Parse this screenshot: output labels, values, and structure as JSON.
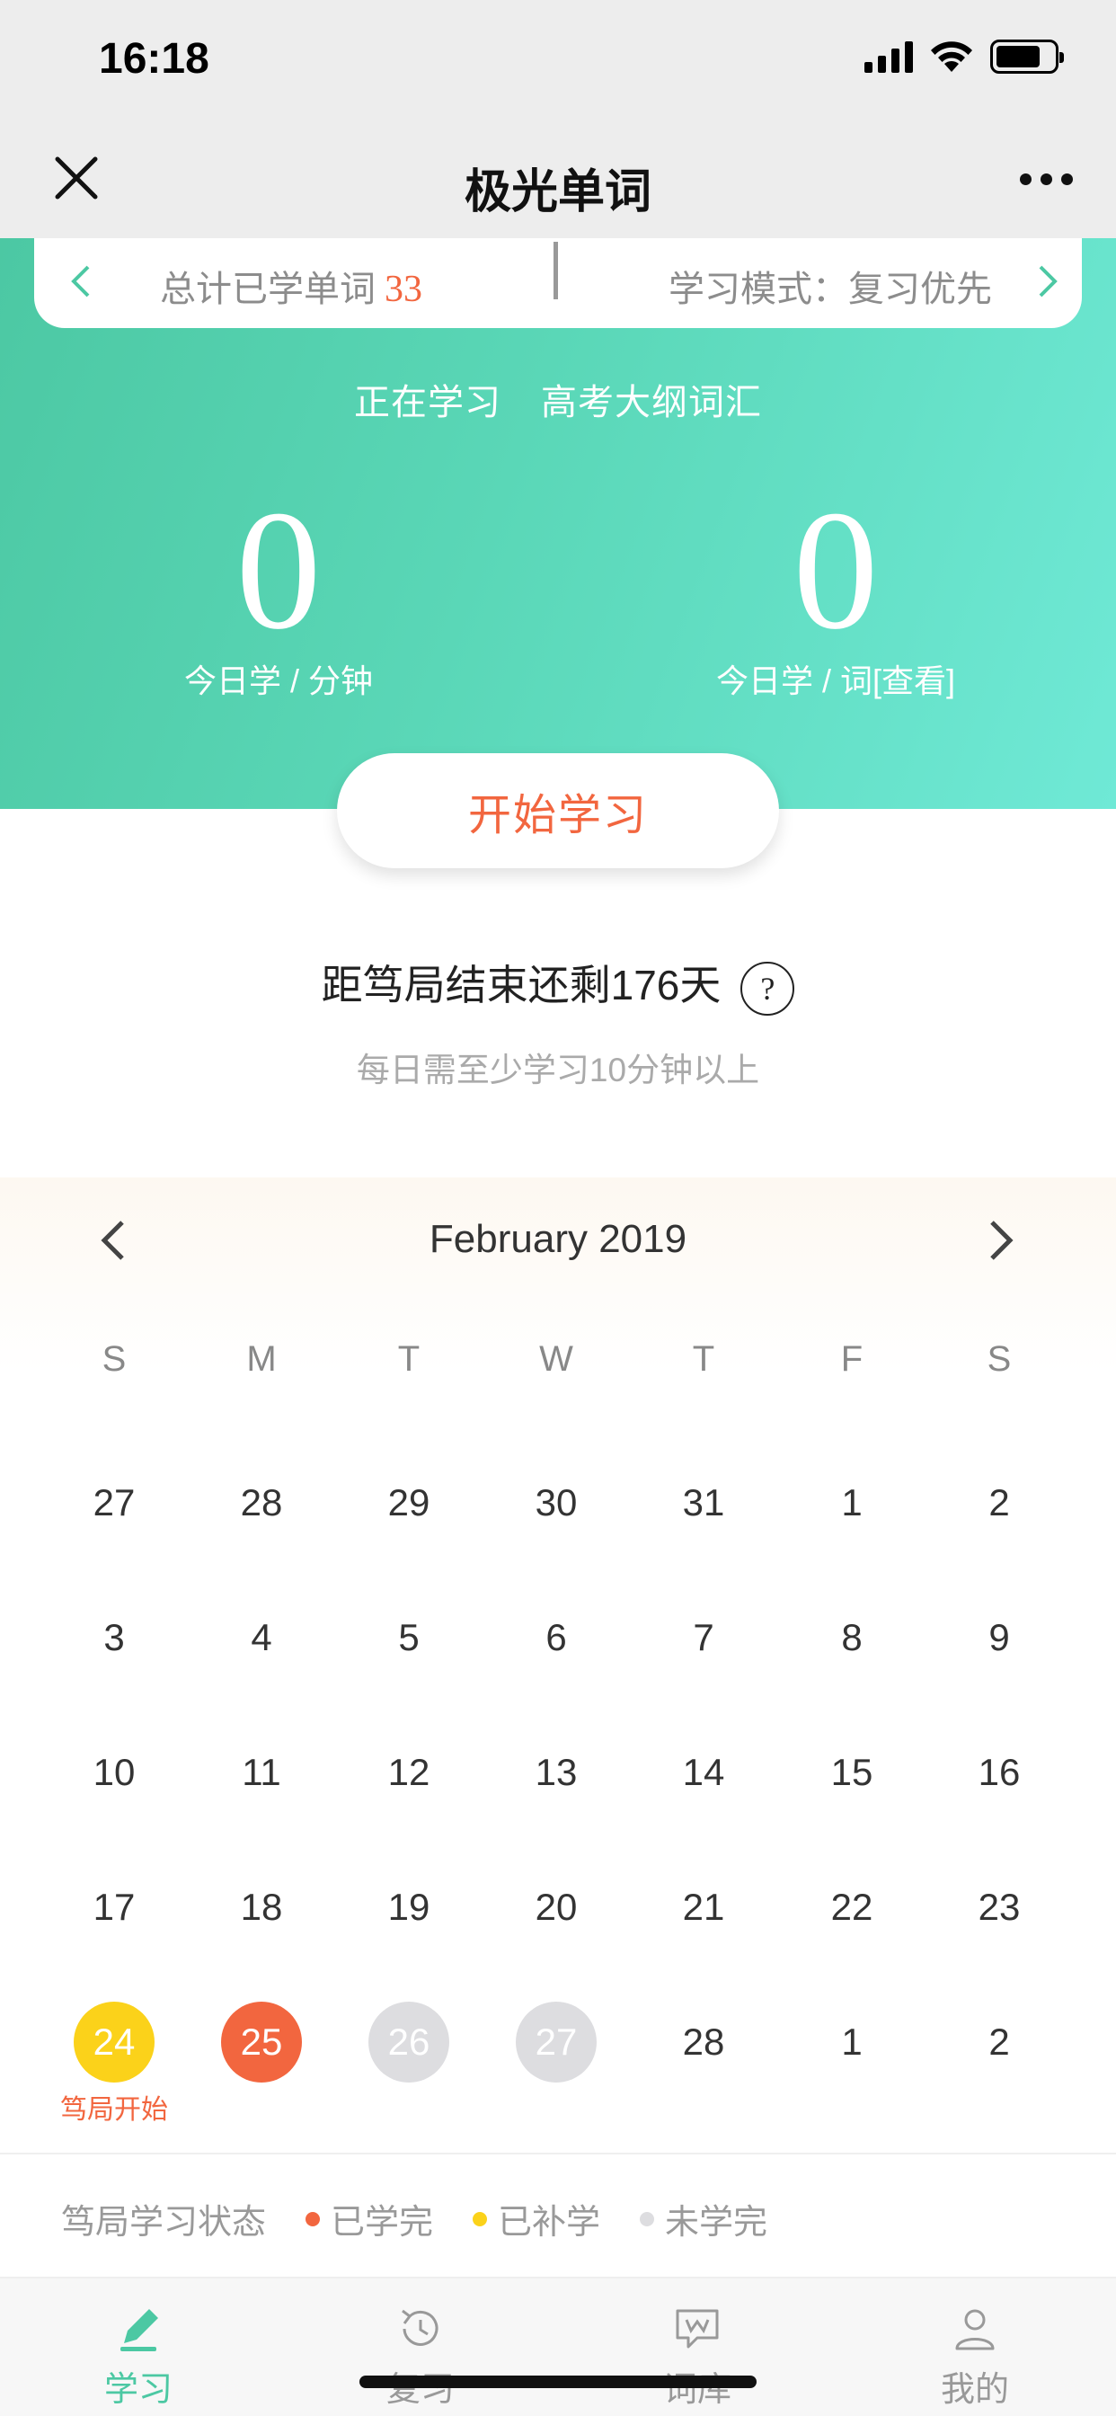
{
  "status_bar": {
    "time": "16:18"
  },
  "nav": {
    "title": "极光单词"
  },
  "summary": {
    "total_label": "总计已学单词",
    "total_count": "33",
    "mode_label": "学习模式：复习优先"
  },
  "learning": {
    "prefix": "正在学习",
    "book": "高考大纲词汇"
  },
  "stats": {
    "minutes_value": "0",
    "minutes_label": "今日学 / 分钟",
    "words_value": "0",
    "words_label": "今日学 / 词[查看]"
  },
  "start_button": "开始学习",
  "countdown": {
    "text": "距笃局结束还剩176天",
    "help": "?",
    "sub": "每日需至少学习10分钟以上"
  },
  "calendar": {
    "month_label": "February 2019",
    "weekdays": [
      "S",
      "M",
      "T",
      "W",
      "T",
      "F",
      "S"
    ],
    "weeks": [
      [
        "27",
        "28",
        "29",
        "30",
        "31",
        "1",
        "2"
      ],
      [
        "3",
        "4",
        "5",
        "6",
        "7",
        "8",
        "9"
      ],
      [
        "10",
        "11",
        "12",
        "13",
        "14",
        "15",
        "16"
      ],
      [
        "17",
        "18",
        "19",
        "20",
        "21",
        "22",
        "23"
      ],
      [
        "24",
        "25",
        "26",
        "27",
        "28",
        "1",
        "2"
      ]
    ],
    "start_note": "笃局开始",
    "colors": {
      "completed": "#f2663f",
      "makeup": "#fbd21a",
      "incomplete": "#dddde0"
    }
  },
  "legend": {
    "title": "笃局学习状态",
    "completed": "已学完",
    "makeup": "已补学",
    "incomplete": "未学完"
  },
  "tabs": [
    {
      "label": "学习",
      "icon": "pencil-icon"
    },
    {
      "label": "复习",
      "icon": "history-icon"
    },
    {
      "label": "词库",
      "icon": "word-bubble-icon"
    },
    {
      "label": "我的",
      "icon": "user-icon"
    }
  ],
  "accent": "#4cc8a3"
}
